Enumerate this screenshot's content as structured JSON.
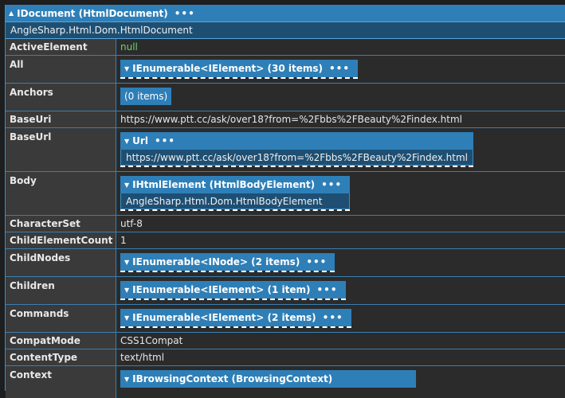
{
  "header": {
    "title": "IDocument (HtmlDocument)",
    "subtitle": "AngleSharp.Html.Dom.HtmlDocument",
    "dots": "•••"
  },
  "rows": [
    {
      "name": "ActiveElement",
      "value": "null"
    },
    {
      "name": "All",
      "node": "IEnumerable<IElement> (30 items)"
    },
    {
      "name": "Anchors",
      "value": "(0 items)"
    },
    {
      "name": "BaseUri",
      "value": "https://www.ptt.cc/ask/over18?from=%2Fbbs%2FBeauty%2Findex.html"
    },
    {
      "name": "BaseUrl",
      "node": "Url",
      "inner": "https://www.ptt.cc/ask/over18?from=%2Fbbs%2FBeauty%2Findex.html"
    },
    {
      "name": "Body",
      "node": "IHtmlElement (HtmlBodyElement)",
      "inner": "AngleSharp.Html.Dom.HtmlBodyElement"
    },
    {
      "name": "CharacterSet",
      "value": "utf-8"
    },
    {
      "name": "ChildElementCount",
      "value": "1"
    },
    {
      "name": "ChildNodes",
      "node": "IEnumerable<INode> (2 items)"
    },
    {
      "name": "Children",
      "node": "IEnumerable<IElement> (1 item)"
    },
    {
      "name": "Commands",
      "node": "IEnumerable<IElement> (2 items)"
    },
    {
      "name": "CompatMode",
      "value": "CSS1Compat"
    },
    {
      "name": "ContentType",
      "value": "text/html"
    },
    {
      "name": "Context",
      "node": "IBrowsingContext (BrowsingContext)"
    }
  ]
}
